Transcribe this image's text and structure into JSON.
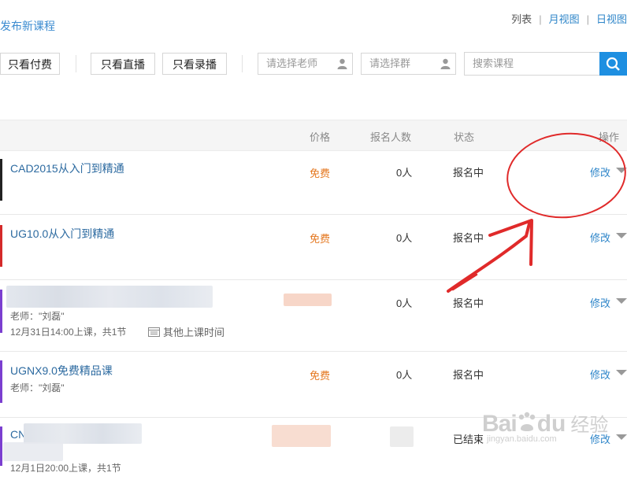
{
  "header": {
    "publish_label": "发布新课程"
  },
  "view_switch": {
    "list": "列表",
    "month": "月视图",
    "day": "日视图"
  },
  "filters": {
    "paid": "只看付费",
    "live": "只看直播",
    "recorded": "只看录播",
    "teacher_placeholder": "请选择老师",
    "group_placeholder": "请选择群",
    "search_placeholder": "搜索课程"
  },
  "table": {
    "headers": {
      "price": "价格",
      "enrolled": "报名人数",
      "status": "状态",
      "action": "操作"
    },
    "rows": [
      {
        "title": "CAD2015从入门到精通",
        "price": "免费",
        "enrolled": "0人",
        "status": "报名中",
        "action": "修改",
        "bar_color": "#222222"
      },
      {
        "title": "UG10.0从入门到精通",
        "price": "免费",
        "enrolled": "0人",
        "status": "报名中",
        "action": "修改",
        "bar_color": "#d42a2a"
      },
      {
        "teacher": "老师：\"刘磊\"",
        "time": "12月31日14:00上课，共1节",
        "other_time": "其他上课时间",
        "enrolled": "0人",
        "status": "报名中",
        "action": "修改",
        "bar_color": "#7b3fd0"
      },
      {
        "title": "UGNX9.0免费精品课",
        "teacher": "老师：\"刘磊\"",
        "price": "免费",
        "enrolled": "0人",
        "status": "报名中",
        "action": "修改",
        "bar_color": "#7b3fd0"
      },
      {
        "title": "CN",
        "time": "12月1日20:00上课，共1节",
        "status": "已结束",
        "action": "修改",
        "bar_color": "#7b3fd0"
      }
    ]
  },
  "watermark": {
    "brand": "Bai",
    "brand2": "du",
    "cn": "经验",
    "url": "jingyan.baidu.com"
  },
  "colors": {
    "accent": "#2f86c9",
    "search_button": "#1e8fe1",
    "price": "#e4771f",
    "annotation": "#e02a2a"
  }
}
